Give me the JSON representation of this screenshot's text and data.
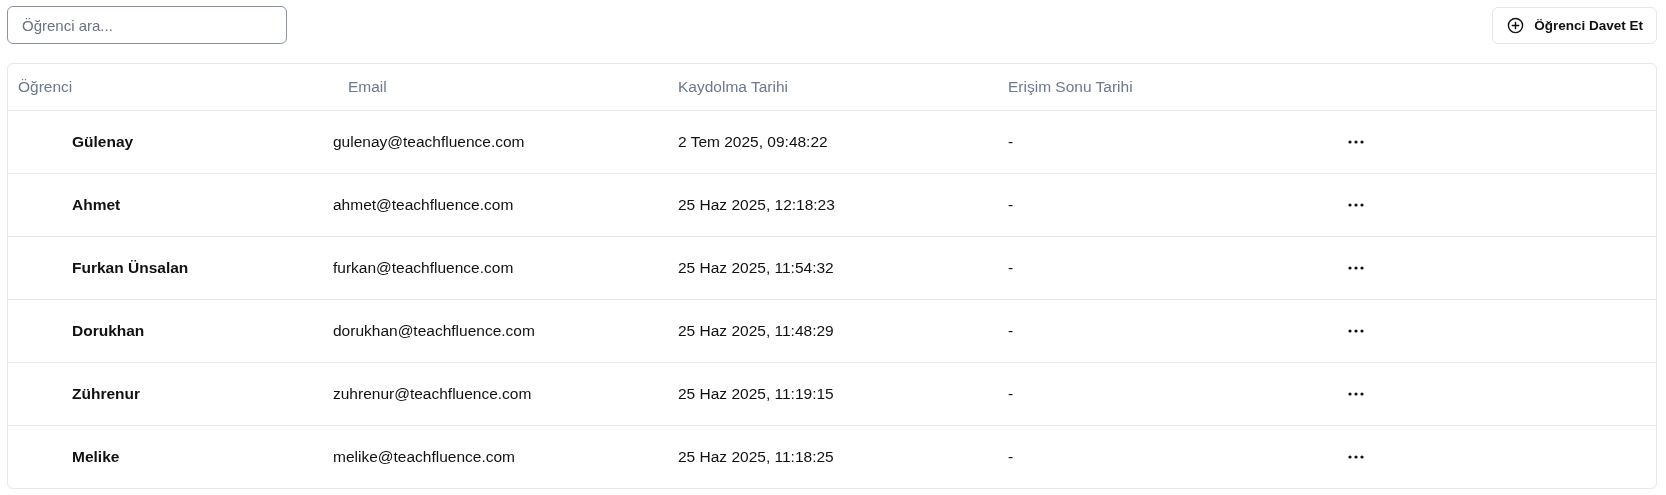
{
  "search": {
    "placeholder": "Öğrenci ara..."
  },
  "invite_button": {
    "label": "Öğrenci Davet Et"
  },
  "table": {
    "columns": [
      "Öğrenci",
      "Email",
      "Kaydolma Tarihi",
      "Erişim Sonu Tarihi"
    ],
    "rows": [
      {
        "name": "Gülenay",
        "email": "gulenay@teachfluence.com",
        "enrolled": "2 Tem 2025, 09:48:22",
        "access_end": "-"
      },
      {
        "name": "Ahmet",
        "email": "ahmet@teachfluence.com",
        "enrolled": "25 Haz 2025, 12:18:23",
        "access_end": "-"
      },
      {
        "name": "Furkan Ünsalan",
        "email": "furkan@teachfluence.com",
        "enrolled": "25 Haz 2025, 11:54:32",
        "access_end": "-"
      },
      {
        "name": "Dorukhan",
        "email": "dorukhan@teachfluence.com",
        "enrolled": "25 Haz 2025, 11:48:29",
        "access_end": "-"
      },
      {
        "name": "Zührenur",
        "email": "zuhrenur@teachfluence.com",
        "enrolled": "25 Haz 2025, 11:19:15",
        "access_end": "-"
      },
      {
        "name": "Melike",
        "email": "melike@teachfluence.com",
        "enrolled": "25 Haz 2025, 11:18:25",
        "access_end": "-"
      }
    ]
  }
}
